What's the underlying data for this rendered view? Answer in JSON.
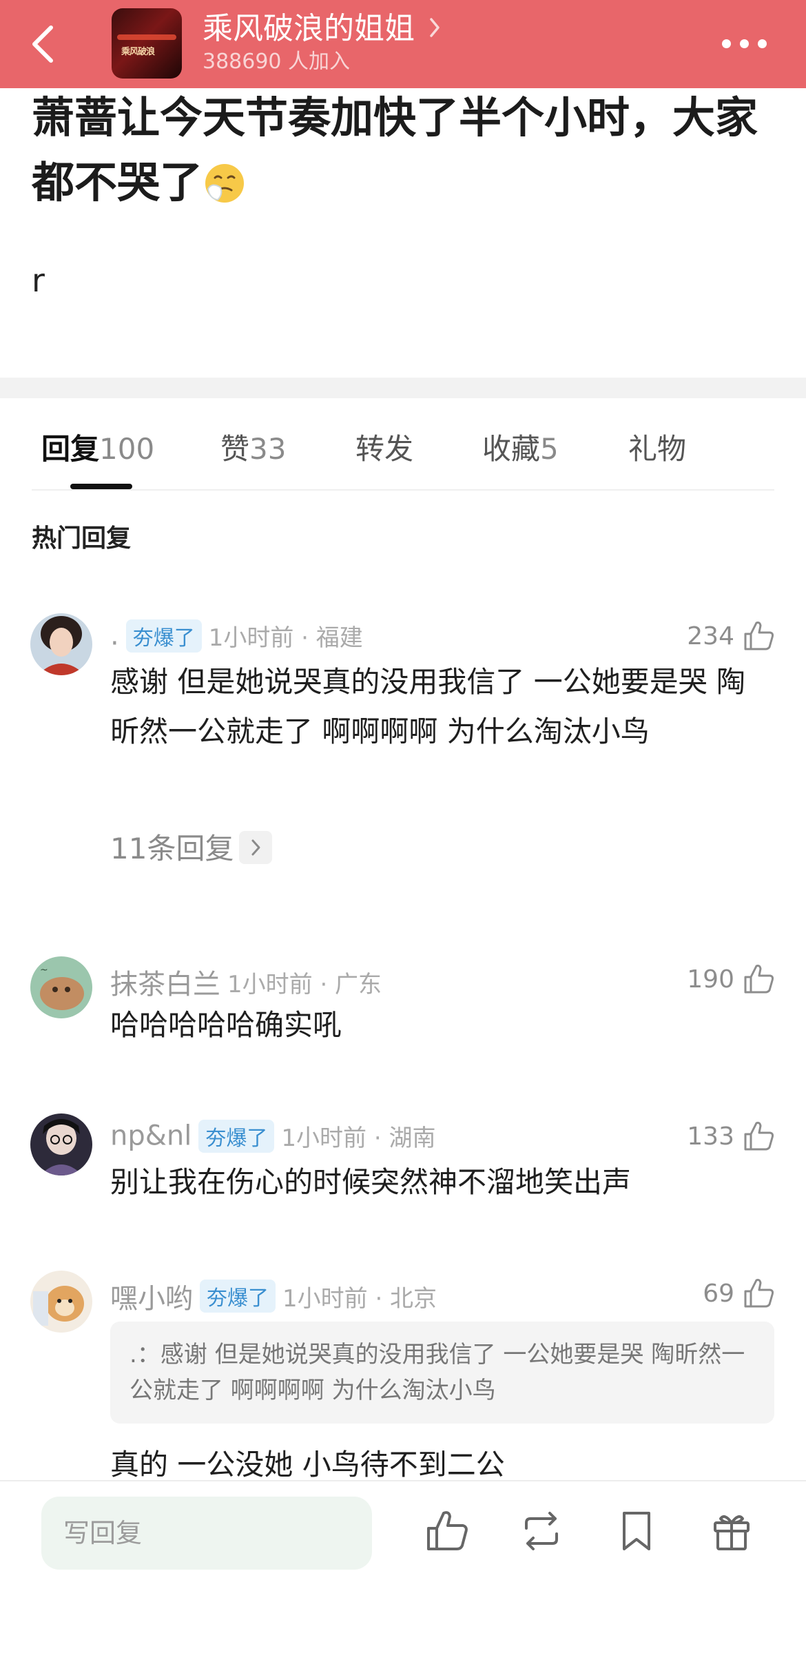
{
  "header": {
    "group_name": "乘风破浪的姐姐",
    "member_count": "388690 人加入",
    "logo_text": "乘风破浪",
    "accent_color": "#e8666a"
  },
  "post": {
    "title": "萧蔷让今天节奏加快了半个小时，大家都不哭了",
    "title_emoji": "sneezing-face-emoji",
    "body": "r"
  },
  "tabs": [
    {
      "label": "回复",
      "count": "100",
      "active": true
    },
    {
      "label": "赞",
      "count": "33"
    },
    {
      "label": "转发",
      "count": ""
    },
    {
      "label": "收藏",
      "count": "5"
    },
    {
      "label": "礼物",
      "count": ""
    }
  ],
  "hot_heading": "热门回复",
  "comments": [
    {
      "username": ".",
      "badge": "夯爆了",
      "meta": "1小时前 · 福建",
      "likes": "234",
      "text": "感谢 但是她说哭真的没用我信了 一公她要是哭 陶昕然一公就走了 啊啊啊啊 为什么淘汰小鸟",
      "replies_label": "11条回复"
    },
    {
      "username": "抹茶白兰",
      "badge": "",
      "meta": "1小时前 · 广东",
      "likes": "190",
      "text": "哈哈哈哈哈确实吼"
    },
    {
      "username": "np&nl",
      "badge": "夯爆了",
      "meta": "1小时前 · 湖南",
      "likes": "133",
      "text": "别让我在伤心的时候突然神不溜地笑出声"
    },
    {
      "username": "嘿小哟",
      "badge": "夯爆了",
      "meta": "1小时前 · 北京",
      "likes": "69",
      "quote": ".：感谢 但是她说哭真的没用我信了 一公她要是哭 陶昕然一公就走了 啊啊啊啊 为什么淘汰小鸟",
      "text": "真的  一公没她 小鸟待不到二公"
    }
  ],
  "bottom_bar": {
    "reply_placeholder": "写回复",
    "icons": [
      "thumbs-up-icon",
      "repost-icon",
      "bookmark-icon",
      "gift-icon"
    ]
  }
}
